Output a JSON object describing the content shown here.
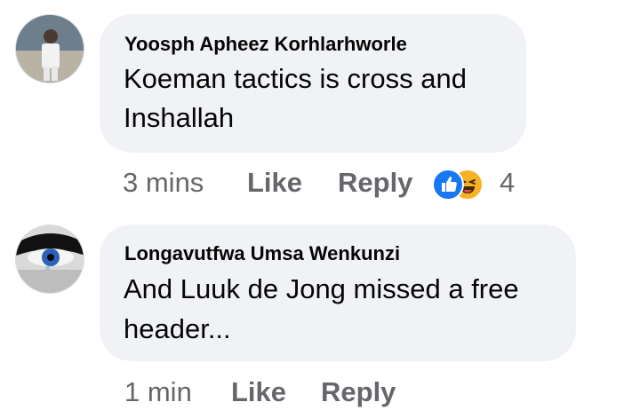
{
  "comments": [
    {
      "author": "Yoosph Apheez Korhlarhworle",
      "text_lines": [
        "Koeman tactics is cross and",
        "Inshallah"
      ],
      "time": "3 mins",
      "like_label": "Like",
      "reply_label": "Reply",
      "reaction_count": "4",
      "reaction_icons": [
        "like-icon",
        "haha-icon"
      ]
    },
    {
      "author": "Longavutfwa Umsa Wenkunzi",
      "text_lines": [
        "And Luuk de Jong missed a free",
        "header..."
      ],
      "time": "1 min",
      "like_label": "Like",
      "reply_label": "Reply"
    }
  ],
  "colors": {
    "bubble": "#f0f2f5",
    "secondary_text": "#65676b",
    "like_blue": "#1877f2",
    "haha_yellow": "#f7b125"
  }
}
